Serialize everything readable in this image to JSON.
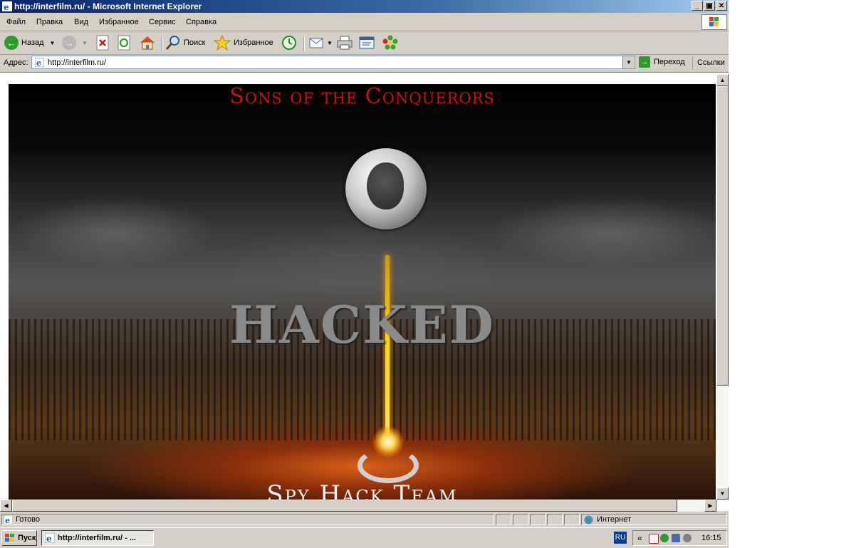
{
  "window": {
    "title": "http://interfilm.ru/ - Microsoft Internet Explorer",
    "minimize_label": "_",
    "restore_label": "▣",
    "close_label": "✕"
  },
  "menu": {
    "items": [
      "Файл",
      "Правка",
      "Вид",
      "Избранное",
      "Сервис",
      "Справка"
    ]
  },
  "toolbar": {
    "back_label": "Назад",
    "search_label": "Поиск",
    "favorites_label": "Избранное"
  },
  "address": {
    "label": "Адрес:",
    "url": "http://interfilm.ru/",
    "go_label": "Переход",
    "links_label": "Ссылки"
  },
  "page": {
    "top_title": "Sons of the Conquerors",
    "hacked_text": "HACKED",
    "team_text": "Spy Hack Team"
  },
  "status": {
    "text": "Готово",
    "zone": "Интернет"
  },
  "taskbar": {
    "start_label": "Пуск",
    "task_label": "http://interfilm.ru/ - ...",
    "lang": "RU",
    "clock": "16:15",
    "tray_expand": "«"
  },
  "colors": {
    "title_red": "#d01010",
    "titlebar_blue": "#0a246a"
  }
}
